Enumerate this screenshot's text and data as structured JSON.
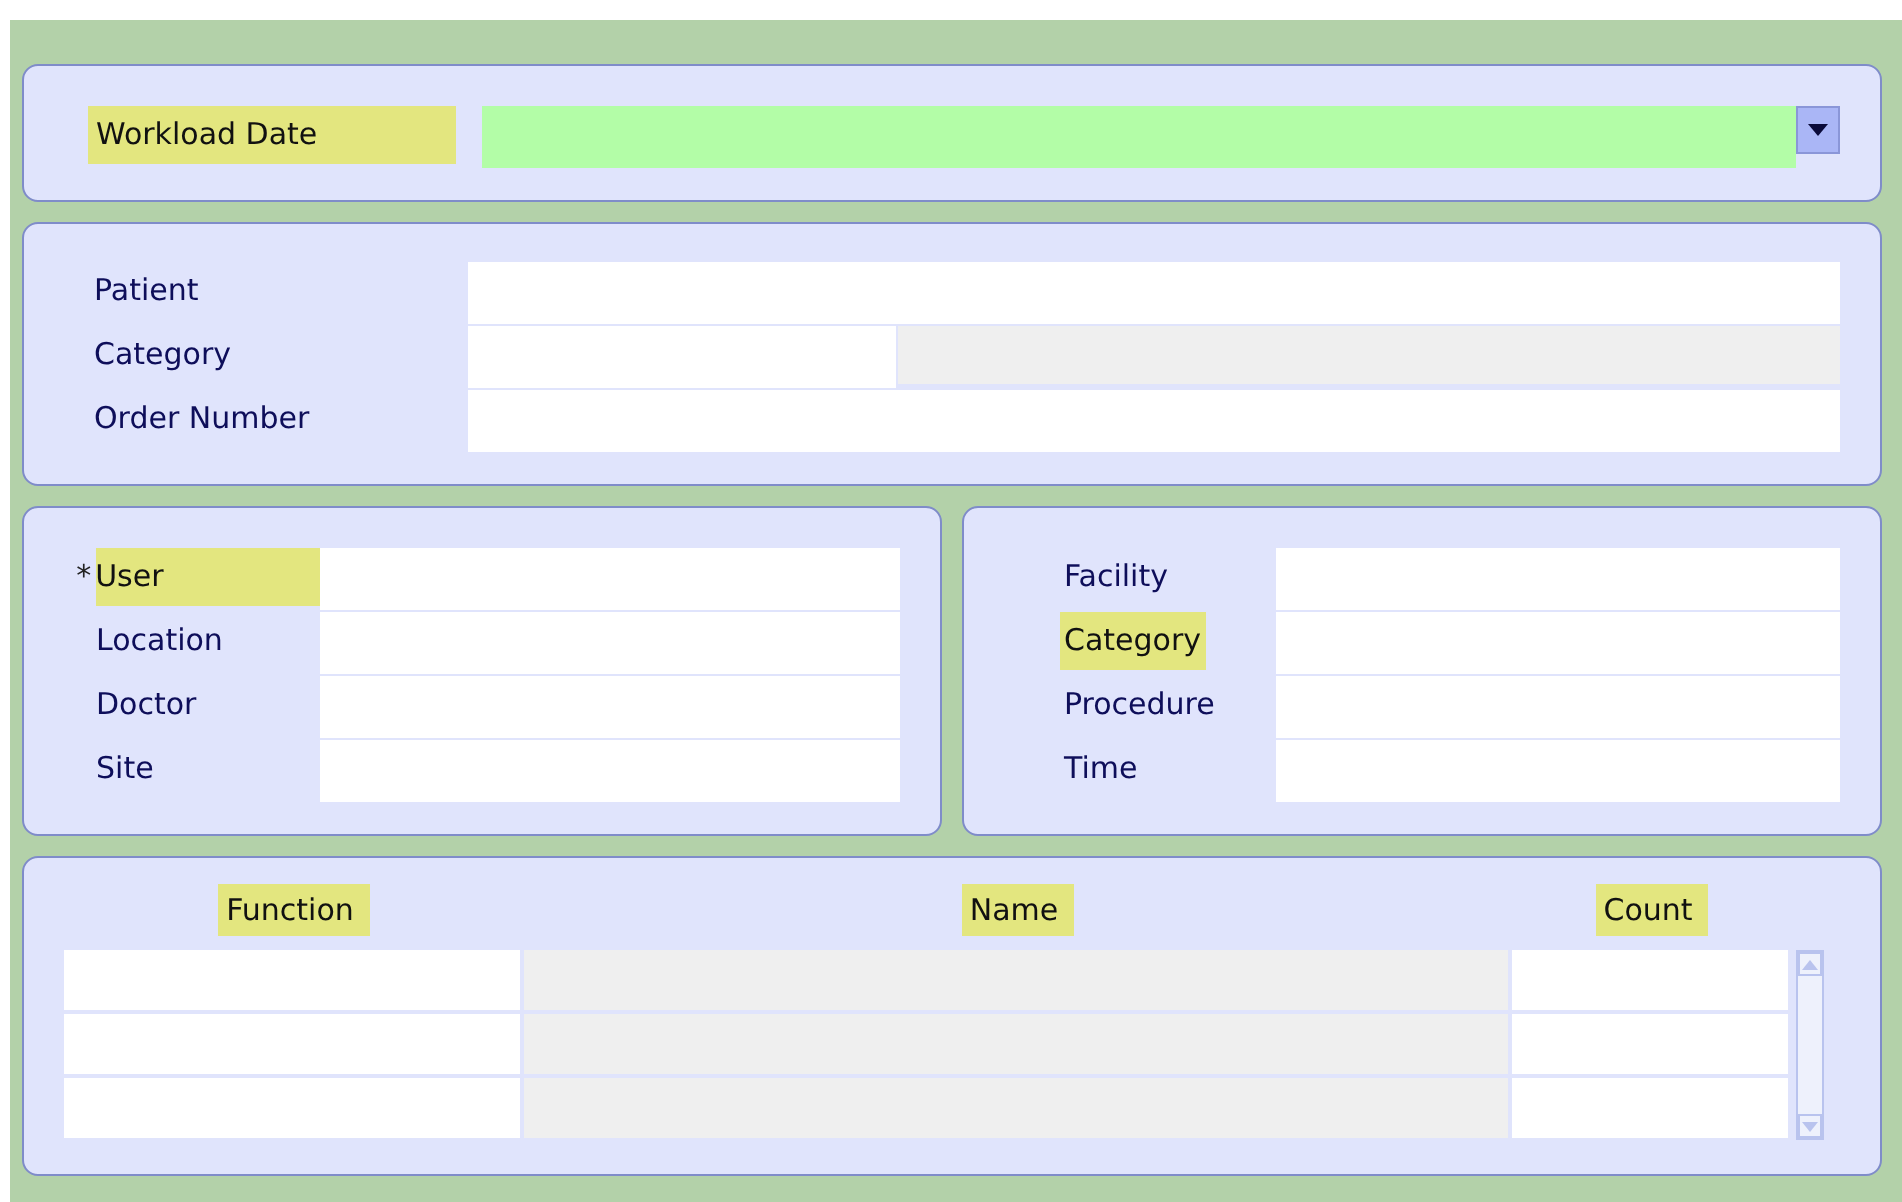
{
  "workload_date": {
    "label": "Workload Date",
    "highlighted": true
  },
  "order_fields": [
    {
      "label": "Patient",
      "kind": "single"
    },
    {
      "label": "Category",
      "kind": "split"
    },
    {
      "label": "Order Number",
      "kind": "single"
    }
  ],
  "left_fields": [
    {
      "label": "User",
      "required_mark": "*",
      "highlighted": true
    },
    {
      "label": "Location",
      "highlighted": false
    },
    {
      "label": "Doctor",
      "highlighted": false
    },
    {
      "label": "Site",
      "highlighted": false
    }
  ],
  "right_fields": [
    {
      "label": "Facility",
      "highlighted": false
    },
    {
      "label": "Category",
      "highlighted": true
    },
    {
      "label": "Procedure",
      "highlighted": false
    },
    {
      "label": "Time",
      "highlighted": false
    }
  ],
  "table": {
    "columns": [
      {
        "label": "Function",
        "highlighted": true,
        "disabled": false
      },
      {
        "label": "Name",
        "highlighted": true,
        "disabled": true
      },
      {
        "label": "Count",
        "highlighted": true,
        "disabled": false
      }
    ],
    "rows": [
      {
        "selected": false
      },
      {
        "selected": false
      },
      {
        "selected": false
      }
    ]
  }
}
